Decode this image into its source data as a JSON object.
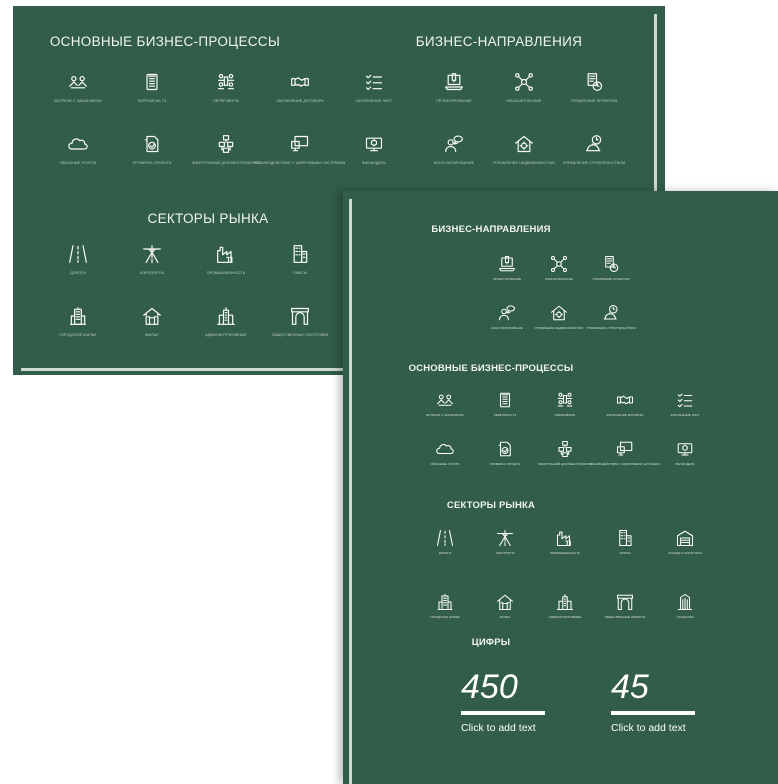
{
  "back": {
    "sections": [
      {
        "title": "ОСНОВНЫЕ БИЗНЕС-ПРОЦЕССЫ",
        "items": [
          {
            "icon": "people-meeting-icon",
            "label": "ВСТРЕЧИ С ЗАКАЗЧИКОМ"
          },
          {
            "icon": "document-list-icon",
            "label": "ПЕРЕПИСКА ТЗ"
          },
          {
            "icon": "team-meeting-icon",
            "label": "ПЕРЕГОВОРЫ"
          },
          {
            "icon": "handshake-icon",
            "label": "ЗАКЛЮЧЕНИЕ ДОГОВОРА"
          },
          {
            "icon": "checklist-icon",
            "label": "ЗАПОЛНЕНИЕ ЛИСТ"
          },
          {
            "icon": "cloud-icon",
            "label": "ОБЛАЧНЫЕ УСЛУГИ"
          },
          {
            "icon": "document-check-icon",
            "label": "ПРОВЕРКА ПРОЕКТА"
          },
          {
            "icon": "flowchart-icon",
            "label": "ЭЛЕКТРОННЫЙ ДОКУМЕНТООБОРОТ"
          },
          {
            "icon": "devices-icon",
            "label": "ВЗАИМОДЕЙСТВИЕ С ЦИФРОВЫМИ СИСТЕМАМИ"
          },
          {
            "icon": "bim-model-icon",
            "label": "BIM-МОДЕЛЬ"
          }
        ]
      },
      {
        "title": "БИЗНЕС-НАПРАВЛЕНИЯ",
        "items": [
          {
            "icon": "laptop-design-icon",
            "label": "ПРОЕКТИРОВАНИЕ"
          },
          {
            "icon": "network-hub-icon",
            "label": "ИЗЫСКАТЕЛЬСКИЕ"
          },
          {
            "icon": "document-clock-icon",
            "label": "УПРАВЛЕНИЕ ПРОЕКТОМ"
          },
          {
            "icon": "consulting-icon",
            "label": "КОНСУЛЬТИРОВАНИЕ"
          },
          {
            "icon": "house-gear-icon",
            "label": "УПРАВЛЕНИЕ НЕДВИЖИМОСТЬЮ"
          },
          {
            "icon": "service-clock-icon",
            "label": "УПРАВЛЕНИЕ СТРОИТЕЛЬСТВОМ"
          }
        ]
      },
      {
        "title": "СЕКТОРЫ РЫНКА",
        "items": [
          {
            "icon": "road-icon",
            "label": "ДОРОГИ"
          },
          {
            "icon": "airport-icon",
            "label": "АЭРОПОРТЫ"
          },
          {
            "icon": "factory-icon",
            "label": "ПРОМЫШЛЕННОСТЬ"
          },
          {
            "icon": "office-icon",
            "label": "ОФИСЫ"
          },
          {
            "icon": "city-building-icon",
            "label": "ГОРОДСКОЕ ЖИЛЬЕ"
          },
          {
            "icon": "house-icon",
            "label": "ЖИЛЬЕ"
          },
          {
            "icon": "tower-icon",
            "label": "АДМИНИСТРАТИВНЫЕ"
          },
          {
            "icon": "arch-icon",
            "label": "ОБЩЕСТВЕННЫЕ ПОСТРОЙКИ"
          }
        ]
      }
    ]
  },
  "front": {
    "sections": [
      {
        "title": "БИЗНЕС-НАПРАВЛЕНИЯ",
        "items": [
          {
            "icon": "laptop-design-icon",
            "label": "ПРОЕКТИРОВАНИЕ"
          },
          {
            "icon": "network-hub-icon",
            "label": "ИЗЫСКАТЕЛЬСКИЕ"
          },
          {
            "icon": "document-clock-icon",
            "label": "УПРАВЛЕНИЕ ПРОЕКТОМ"
          },
          {
            "icon": "consulting-icon",
            "label": "КОНСУЛЬТИРОВАНИЕ"
          },
          {
            "icon": "house-gear-icon",
            "label": "УПРАВЛЕНИЕ НЕДВИЖИМОСТЬЮ"
          },
          {
            "icon": "service-clock-icon",
            "label": "УПРАВЛЕНИЕ СТРОИТЕЛЬСТВОМ"
          }
        ]
      },
      {
        "title": "ОСНОВНЫЕ БИЗНЕС-ПРОЦЕССЫ",
        "items": [
          {
            "icon": "people-meeting-icon",
            "label": "ВСТРЕЧИ С ЗАКАЗЧИКОМ"
          },
          {
            "icon": "document-list-icon",
            "label": "ПЕРЕПИСКА ТЗ"
          },
          {
            "icon": "team-meeting-icon",
            "label": "ПЕРЕГОВОРЫ"
          },
          {
            "icon": "handshake-icon",
            "label": "ЗАКЛЮЧЕНИЕ ДОГОВОРА"
          },
          {
            "icon": "checklist-icon",
            "label": "ЗАПОЛНЕНИЕ ЛИСТ"
          },
          {
            "icon": "cloud-icon",
            "label": "ОБЛАЧНЫЕ УСЛУГИ"
          },
          {
            "icon": "document-check-icon",
            "label": "ПРОВЕРКА ПРОЕКТА"
          },
          {
            "icon": "flowchart-icon",
            "label": "ЭЛЕКТРОННЫЙ ДОКУМЕНТООБОРОТ"
          },
          {
            "icon": "devices-icon",
            "label": "ВЗАИМОДЕЙСТВИЕ С ЦИФРОВЫМИ СИСТЕМАМИ"
          },
          {
            "icon": "bim-model-icon",
            "label": "BIM-МОДЕЛЬ"
          }
        ]
      },
      {
        "title": "СЕКТОРЫ РЫНКА",
        "items": [
          {
            "icon": "road-icon",
            "label": "ДОРОГИ"
          },
          {
            "icon": "airport-icon",
            "label": "АЭРОПОРТЫ"
          },
          {
            "icon": "factory-icon",
            "label": "ПРОМЫШЛЕННОСТЬ"
          },
          {
            "icon": "office-icon",
            "label": "ОФИСЫ"
          },
          {
            "icon": "warehouse-icon",
            "label": "СКЛАДЫ И ЛОГИСТИКА"
          },
          {
            "icon": "city-building-icon",
            "label": "ГОРОДСКОЕ ЖИЛЬЕ"
          },
          {
            "icon": "house-icon",
            "label": "ЖИЛЬЕ"
          },
          {
            "icon": "tower-icon",
            "label": "АДМИНИСТРАТИВНЫЕ"
          },
          {
            "icon": "arch-icon",
            "label": "ОБЩЕСТВЕННЫЕ ОБЪЕКТЫ"
          },
          {
            "icon": "stadium-icon",
            "label": "СТАДИОНЫ"
          }
        ]
      },
      {
        "title": "ЦИФРЫ",
        "items": []
      }
    ],
    "stats": [
      {
        "value": "450",
        "caption": "Click to add text"
      },
      {
        "value": "45",
        "caption": "Click to add text"
      }
    ]
  },
  "colors": {
    "background": "#325d48",
    "icon": "#ffffff",
    "caption": "#bcd0c3"
  }
}
